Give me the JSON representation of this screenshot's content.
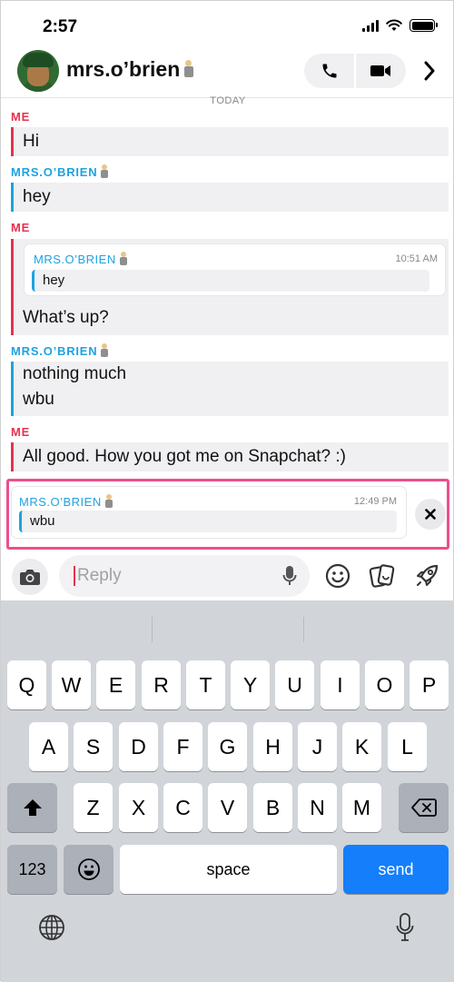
{
  "status": {
    "time": "2:57"
  },
  "header": {
    "contact_name": "mrs.o’brien"
  },
  "chat": {
    "date_label": "TODAY",
    "groups": [
      {
        "sender": "ME",
        "messages": [
          "Hi"
        ]
      },
      {
        "sender": "MRS.O’BRIEN",
        "messages": [
          "hey"
        ]
      },
      {
        "sender": "ME",
        "quote": {
          "name": "MRS.O’BRIEN",
          "time": "10:51 AM",
          "text": "hey"
        },
        "messages": [
          "What’s up?"
        ]
      },
      {
        "sender": "MRS.O’BRIEN",
        "messages": [
          "nothing much",
          "wbu"
        ]
      },
      {
        "sender": "ME",
        "messages": [
          "All good. How you got me on Snapchat? :)"
        ]
      }
    ]
  },
  "reply_preview": {
    "name": "MRS.O’BRIEN",
    "time": "12:49 PM",
    "text": "wbu"
  },
  "input": {
    "placeholder": "Reply"
  },
  "keyboard": {
    "row1": [
      "Q",
      "W",
      "E",
      "R",
      "T",
      "Y",
      "U",
      "I",
      "O",
      "P"
    ],
    "row2": [
      "A",
      "S",
      "D",
      "F",
      "G",
      "H",
      "J",
      "K",
      "L"
    ],
    "row3": [
      "Z",
      "X",
      "C",
      "V",
      "B",
      "N",
      "M"
    ],
    "numbers_key": "123",
    "space_key": "space",
    "send_key": "send"
  },
  "colors": {
    "me": "#e8304e",
    "them": "#1ea2e0",
    "highlight": "#ec4f8b",
    "send": "#147efb"
  },
  "icons": [
    "signal-icon",
    "wifi-icon",
    "battery-icon",
    "phone-icon",
    "video-icon",
    "chevron-right-icon",
    "close-icon",
    "camera-icon",
    "mic-icon",
    "smiley-icon",
    "stickers-icon",
    "rocket-icon",
    "shift-icon",
    "backspace-icon",
    "emoji-icon",
    "globe-icon",
    "dictation-icon"
  ]
}
